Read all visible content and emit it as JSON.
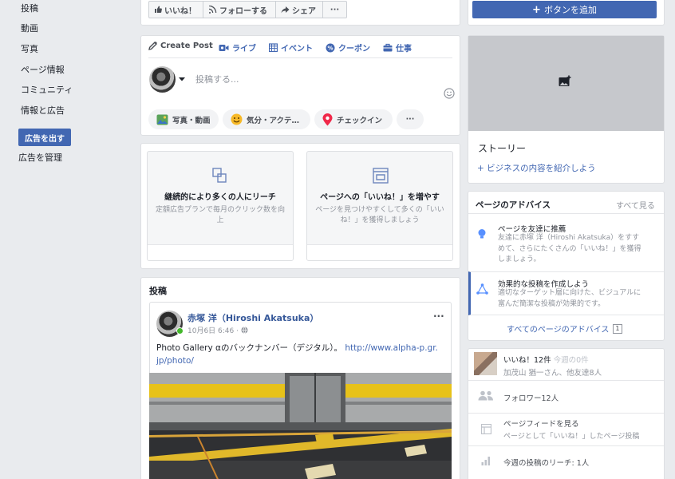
{
  "nav": {
    "items": [
      "投稿",
      "動画",
      "写真",
      "ページ情報",
      "コミュニティ",
      "情報と広告"
    ],
    "ad_button": "広告を出す",
    "manage_ads": "広告を管理"
  },
  "top_actions": {
    "like": "いいね！",
    "follow": "フォローする",
    "share": "シェア",
    "more": "···",
    "add_button": "ボタンを追加"
  },
  "composer": {
    "tabs": [
      "Create Post",
      "ライブ",
      "イベント",
      "クーポン",
      "仕事"
    ],
    "placeholder": "投稿する...",
    "chips": [
      "写真・動画",
      "気分・アクテ…",
      "チェックイン"
    ],
    "more": "···"
  },
  "promos": [
    {
      "title": "継続的により多くの人にリーチ",
      "desc": "定額広告プランで毎月のクリック数を向上"
    },
    {
      "title": "ページへの「いいね！」を増やす",
      "desc": "ページを見つけやすくして多くの「いいね！」を獲得しましょう"
    }
  ],
  "posts_section": {
    "heading": "投稿",
    "author": "赤塚 洋（Hiroshi Akatsuka）",
    "date": "10月6日 6:46 ·",
    "text": "Photo Gallery αのバックナンバー（デジタル）。",
    "link": "http://www.alpha-p.gr.jp/photo/",
    "more": "···"
  },
  "story": {
    "title": "ストーリー",
    "link": "+ ビジネスの内容を紹介しよう"
  },
  "advice": {
    "title": "ページのアドバイス",
    "see_all": "すべて見る",
    "items": [
      {
        "title": "ページを友達に推薦",
        "desc": "友達に赤塚 洋（Hiroshi Akatsuka）をすすめて、さらにたくさんの「いいね！」を獲得しましょう。"
      },
      {
        "title": "効果的な投稿を作成しよう",
        "desc": "適切なターゲット層に向けた、ビジュアルに富んだ簡潔な投稿が効果的です。"
      }
    ],
    "all_link": "すべてのページのアドバイス",
    "all_count": "1"
  },
  "stats": {
    "likes_main": "いいね！12件",
    "likes_week": "今週の0件",
    "likes_sub": "加茂山 猶一さん、他友達8人",
    "followers": "フォロワー12人",
    "feed_title": "ページフィードを見る",
    "feed_sub": "ページとして「いいね！」したページ投稿",
    "reach": "今週の投稿のリーチ: 1人"
  },
  "colors": {
    "brand": "#4267b2",
    "background": "#e9ebee",
    "online": "#42b72a"
  }
}
